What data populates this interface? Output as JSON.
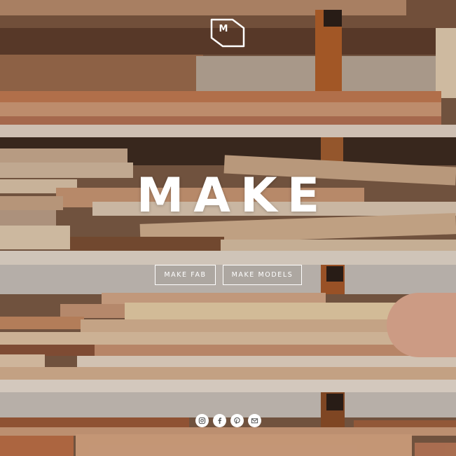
{
  "brand": {
    "logo_letter": "M",
    "title": "MAKE"
  },
  "nav": {
    "buttons": [
      "MAKE FAB",
      "MAKE MODELS"
    ]
  },
  "social": [
    "instagram-icon",
    "facebook-icon",
    "pinterest-icon",
    "mail-icon"
  ],
  "colors": {
    "text": "#ffffff",
    "wood_light": "#d8b896",
    "wood_mid": "#c08a64",
    "wood_dark": "#6b3f26"
  }
}
